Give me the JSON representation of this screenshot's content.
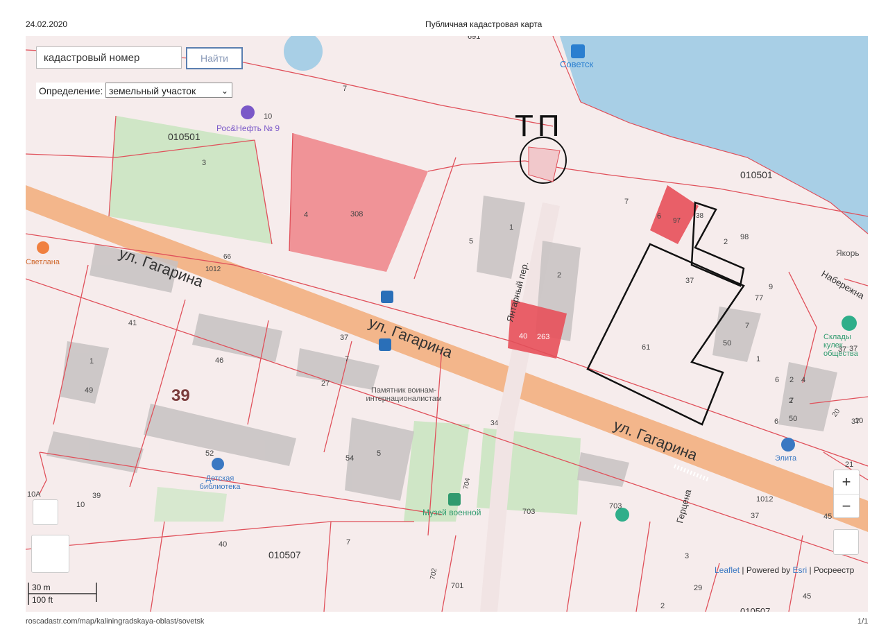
{
  "header": {
    "date": "24.02.2020",
    "title": "Публичная кадастровая карта"
  },
  "search": {
    "placeholder": "кадастровый номер",
    "button_label": "Найти"
  },
  "definition": {
    "label": "Определение:",
    "selected": "земельный участок"
  },
  "map": {
    "annotation": "ТП",
    "streets": {
      "gagarina": "ул. Гагарина",
      "yantarny": "Янтарный пер.",
      "gertsena": "Герцена",
      "naberezhnaya": "Набережна"
    },
    "pois": {
      "rosneft": "Рос&Нефть № 9",
      "sovetsk": "Советск",
      "svetlana": "Светлана",
      "monument": "Памятник воинам-интернационалистам",
      "library": "Детская библиотека",
      "museum": "Музей военной",
      "warehouses": "Склады кулек... общества",
      "elita": "Элита",
      "yakor": "Якорь"
    },
    "quarters": [
      "010501",
      "010501",
      "010507",
      "010507"
    ],
    "big_number": "39",
    "parcels": [
      "691",
      "7",
      "10",
      "3",
      "4",
      "308",
      "5",
      "1",
      "7",
      "6",
      "97",
      "38",
      "2",
      "98",
      "37",
      "77",
      "9",
      "61",
      "7",
      "50",
      "2",
      "40",
      "263",
      "66",
      "1012",
      "41",
      "46",
      "37",
      "27",
      "1",
      "49",
      "7",
      "54",
      "5",
      "52",
      "10A",
      "10",
      "39",
      "40",
      "7",
      "704",
      "703",
      "703",
      "702",
      "701",
      "1012",
      "37",
      "45",
      "3",
      "29",
      "2",
      "45",
      "4",
      "2",
      "6",
      "50",
      "20",
      "21",
      "37",
      "37",
      "10",
      "6",
      "2",
      "7",
      "34",
      "1",
      "37"
    ]
  },
  "zoom": {
    "plus": "+",
    "minus": "−"
  },
  "attribution": {
    "leaflet": "Leaflet",
    "sep1": " | Powered by ",
    "esri": "Esri",
    "rosreestr": " | Росреестр"
  },
  "scale": {
    "metric": "30 m",
    "imperial": "100 ft"
  },
  "footer": {
    "url": "roscadastr.com/map/kaliningradskaya-oblast/sovetsk",
    "page": "1/1"
  },
  "colors": {
    "parcel_line": "#e0505a",
    "parcel_fill_highlight": "#f08a8e",
    "parcel_fill_strong": "#e8505a",
    "road": "#f2ad7a",
    "water": "#a8cfe6",
    "green": "#cfe6c6",
    "outline": "#111111"
  }
}
